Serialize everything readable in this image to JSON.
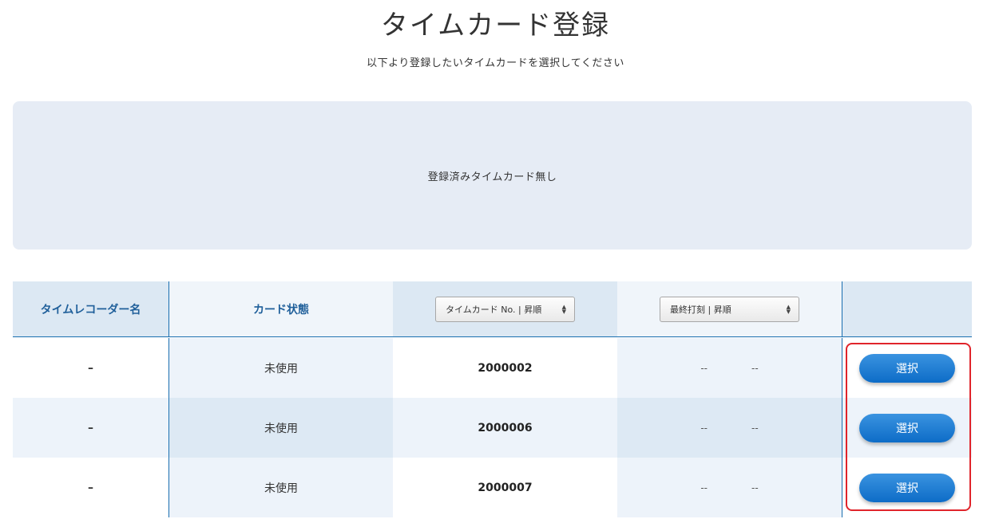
{
  "page": {
    "title": "タイムカード登録",
    "subtitle": "以下より登録したいタイムカードを選択してください"
  },
  "registered": {
    "empty_message": "登録済みタイムカード無し"
  },
  "table": {
    "headers": {
      "recorder_name": "タイムレコーダー名",
      "card_status": "カード状態",
      "card_no_sort": "タイムカード No. | 昇順",
      "last_punch_sort": "最終打刻 | 昇順"
    },
    "rows": [
      {
        "recorder": "–",
        "status": "未使用",
        "card_no": "2000002",
        "last_punch_date": "--",
        "last_punch_time": "--",
        "button": "選択"
      },
      {
        "recorder": "–",
        "status": "未使用",
        "card_no": "2000006",
        "last_punch_date": "--",
        "last_punch_time": "--",
        "button": "選択"
      },
      {
        "recorder": "–",
        "status": "未使用",
        "card_no": "2000007",
        "last_punch_date": "--",
        "last_punch_time": "--",
        "button": "選択"
      }
    ]
  },
  "colors": {
    "accent": "#1a6fb0",
    "button": "#0d6cc7",
    "highlight": "#e0242b"
  }
}
